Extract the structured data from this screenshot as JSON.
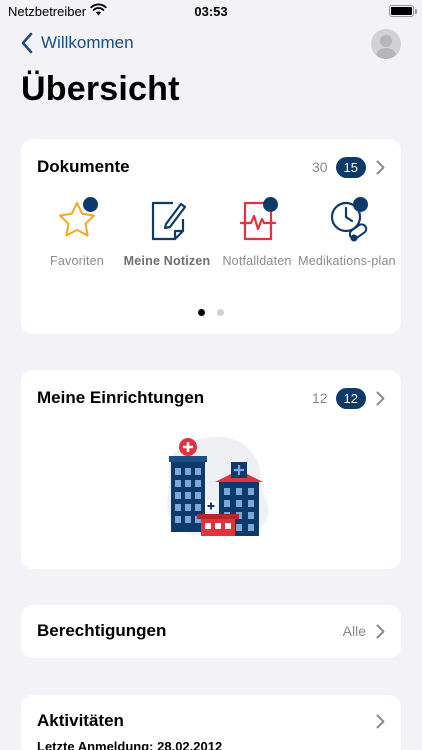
{
  "status_bar": {
    "carrier": "Netzbetreiber",
    "time": "03:53"
  },
  "nav": {
    "back_label": "Willkommen"
  },
  "page_title": "Übersicht",
  "colors": {
    "accent": "#1a4d80",
    "badge": "#0e3a69",
    "red": "#e0333e",
    "background": "#f2f2f7"
  },
  "documents": {
    "title": "Dokumente",
    "count": "30",
    "badge": "15",
    "tiles": [
      {
        "label": "Favoriten",
        "icon": "star-icon"
      },
      {
        "label": "Meine Notizen",
        "icon": "note-edit-icon"
      },
      {
        "label": "Notfalldaten",
        "icon": "emergency-document-icon"
      },
      {
        "label": "Medikations-plan",
        "icon": "medication-clock-icon"
      }
    ]
  },
  "facilities": {
    "title": "Meine Einrichtungen",
    "count": "12",
    "badge": "12",
    "illustration": "hospital-buildings-icon"
  },
  "permissions": {
    "title": "Berechtigungen",
    "value": "Alle"
  },
  "activities": {
    "title": "Aktivitäten",
    "last_login": "Letzte Anmeldung: 28.02.2012"
  }
}
